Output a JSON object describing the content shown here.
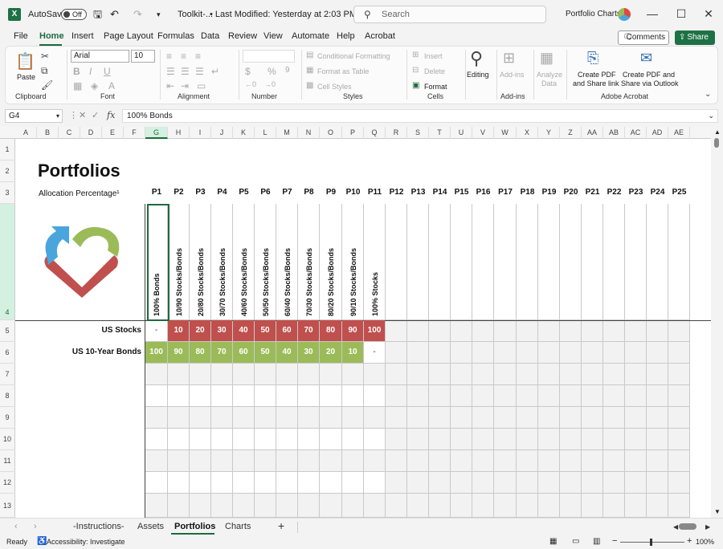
{
  "titlebar": {
    "autosave_label": "AutoSave",
    "autosave_state": "Off",
    "file_name": "Toolkit-...",
    "modified": "• Last Modified: Yesterday at 2:03 PM",
    "search_placeholder": "Search",
    "doc_title": "Portfolio Charts"
  },
  "menu": [
    "File",
    "Home",
    "Insert",
    "Page Layout",
    "Formulas",
    "Data",
    "Review",
    "View",
    "Automate",
    "Help",
    "Acrobat"
  ],
  "buttons": {
    "comments": "Comments",
    "share": "Share"
  },
  "ribbon": {
    "paste": "Paste",
    "clipboard": "Clipboard",
    "font_name": "Arial",
    "font_size": "10",
    "font": "Font",
    "alignment": "Alignment",
    "number": "Number",
    "cond_format": "Conditional Formatting",
    "format_table": "Format as Table",
    "cell_styles": "Cell Styles",
    "styles": "Styles",
    "insert": "Insert",
    "delete": "Delete",
    "format": "Format",
    "cells": "Cells",
    "editing": "Editing",
    "addins": "Add-ins",
    "addins_group": "Add-ins",
    "analyze1": "Analyze",
    "analyze2": "Data",
    "pdf1a": "Create PDF",
    "pdf1b": "and Share link",
    "pdf2a": "Create PDF and",
    "pdf2b": "Share via Outlook",
    "acrobat": "Adobe Acrobat"
  },
  "formula_bar": {
    "name_box": "G4",
    "formula": "100% Bonds"
  },
  "columns": [
    "A",
    "B",
    "C",
    "D",
    "E",
    "F",
    "G",
    "H",
    "I",
    "J",
    "K",
    "L",
    "M",
    "N",
    "O",
    "P",
    "Q",
    "R",
    "S",
    "T",
    "U",
    "V",
    "W",
    "X",
    "Y",
    "Z",
    "AA",
    "AB",
    "AC",
    "AD",
    "AE"
  ],
  "rows": [
    "1",
    "2",
    "3",
    "4",
    "5",
    "6",
    "7",
    "8",
    "9",
    "10",
    "11",
    "12",
    "13"
  ],
  "sheet": {
    "title": "Portfolios",
    "subtitle": "Allocation Percentage¹",
    "portfolio_ids": [
      "P1",
      "P2",
      "P3",
      "P4",
      "P5",
      "P6",
      "P7",
      "P8",
      "P9",
      "P10",
      "P11",
      "P12",
      "P13",
      "P14",
      "P15",
      "P16",
      "P17",
      "P18",
      "P19",
      "P20",
      "P21",
      "P22",
      "P23",
      "P24",
      "P25"
    ],
    "portfolio_names": [
      "100% Bonds",
      "10/90 Stocks/Bonds",
      "20/80 Stocks/Bonds",
      "30/70 Stocks/Bonds",
      "40/60 Stocks/Bonds",
      "50/50 Stocks/Bonds",
      "60/40 Stocks/Bonds",
      "70/30 Stocks/Bonds",
      "80/20 Stocks/Bonds",
      "90/10 Stocks/Bonds",
      "100% Stocks"
    ],
    "us_stocks_label": "US Stocks",
    "us_bonds_label": "US 10-Year Bonds",
    "us_stocks": [
      "-",
      "10",
      "20",
      "30",
      "40",
      "50",
      "60",
      "70",
      "80",
      "90",
      "100"
    ],
    "us_bonds": [
      "100",
      "90",
      "80",
      "70",
      "60",
      "50",
      "40",
      "30",
      "20",
      "10",
      "-"
    ],
    "colors": {
      "stocks": "#c0504d",
      "bonds": "#9bbb59"
    }
  },
  "sheet_tabs": [
    "-Instructions-",
    "Assets",
    "Portfolios",
    "Charts"
  ],
  "active_tab": "Portfolios",
  "status": {
    "ready": "Ready",
    "accessibility": "Accessibility: Investigate",
    "zoom": "100%"
  }
}
